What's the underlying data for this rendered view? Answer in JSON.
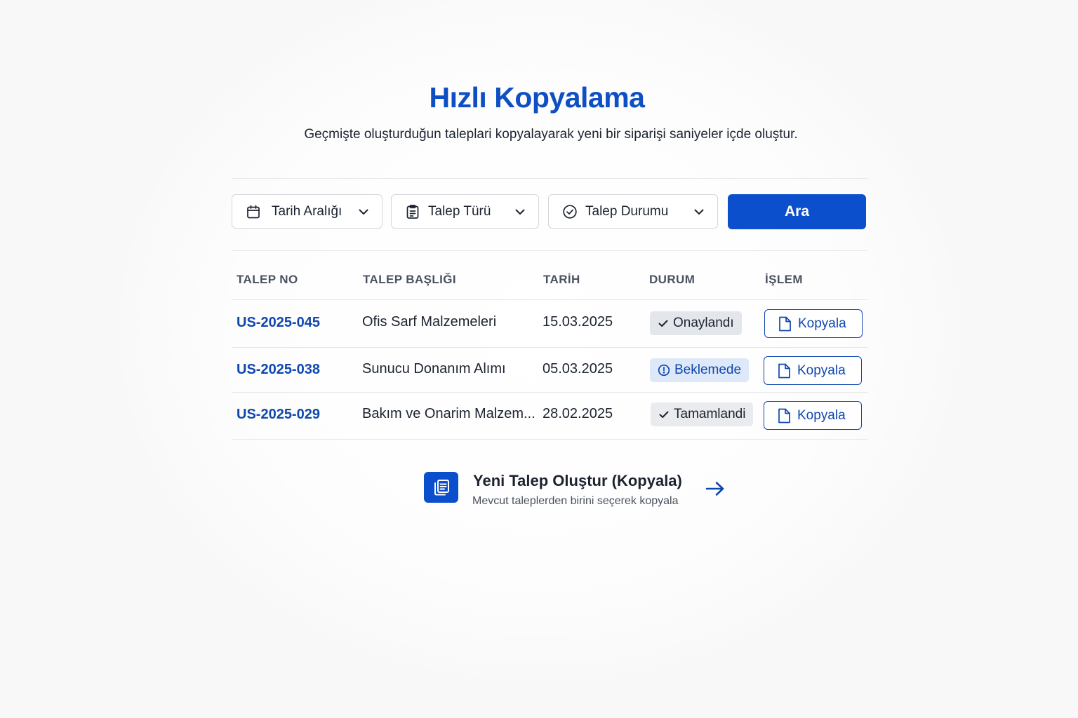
{
  "header": {
    "title": "Hızlı Kopyalama",
    "subtitle": "Geçmişte oluşturduğun taleplari kopyalayarak yeni bir siparişi saniyeler içde oluştur."
  },
  "filters": {
    "date_range": {
      "label": "Tarih Aralığı",
      "icon": "calendar-icon"
    },
    "request_type": {
      "label": "Talep Türü",
      "icon": "clipboard-icon"
    },
    "request_status": {
      "label": "Talep Durumu",
      "icon": "check-circle-icon"
    },
    "search_label": "Ara"
  },
  "table": {
    "headers": {
      "request_no": "TALEP NO",
      "request_title": "TALEP BAŞLIĞI",
      "date": "TARİH",
      "status": "DURUM",
      "action": "İŞLEM"
    },
    "rows": [
      {
        "no": "US-2025-045",
        "title": "Ofis Sarf Malzemeleri",
        "date": "15.03.2025",
        "status": "Onaylandı",
        "status_icon": "check-icon",
        "action": "Kopyala"
      },
      {
        "no": "US-2025-038",
        "title": "Sunucu Donanım Alımı",
        "date": "05.03.2025",
        "status": "Beklemede",
        "status_icon": "clock-icon",
        "action": "Kopyala"
      },
      {
        "no": "US-2025-029",
        "title": "Bakım ve Onarim Malzem...",
        "date": "28.02.2025",
        "status": "Tamamlandi",
        "status_icon": "check-icon",
        "action": "Kopyala"
      }
    ]
  },
  "cta": {
    "title": "Yeni Talep Oluştur (Kopyala)",
    "subtitle": "Mevcut taleplerden birini seçerek kopyala"
  },
  "colors": {
    "primary": "#0b4fcc",
    "link": "#0f47b0",
    "approved_bg": "#e3e6ea",
    "pending_bg": "#dde8f8",
    "completed_bg": "#e9ebee"
  }
}
